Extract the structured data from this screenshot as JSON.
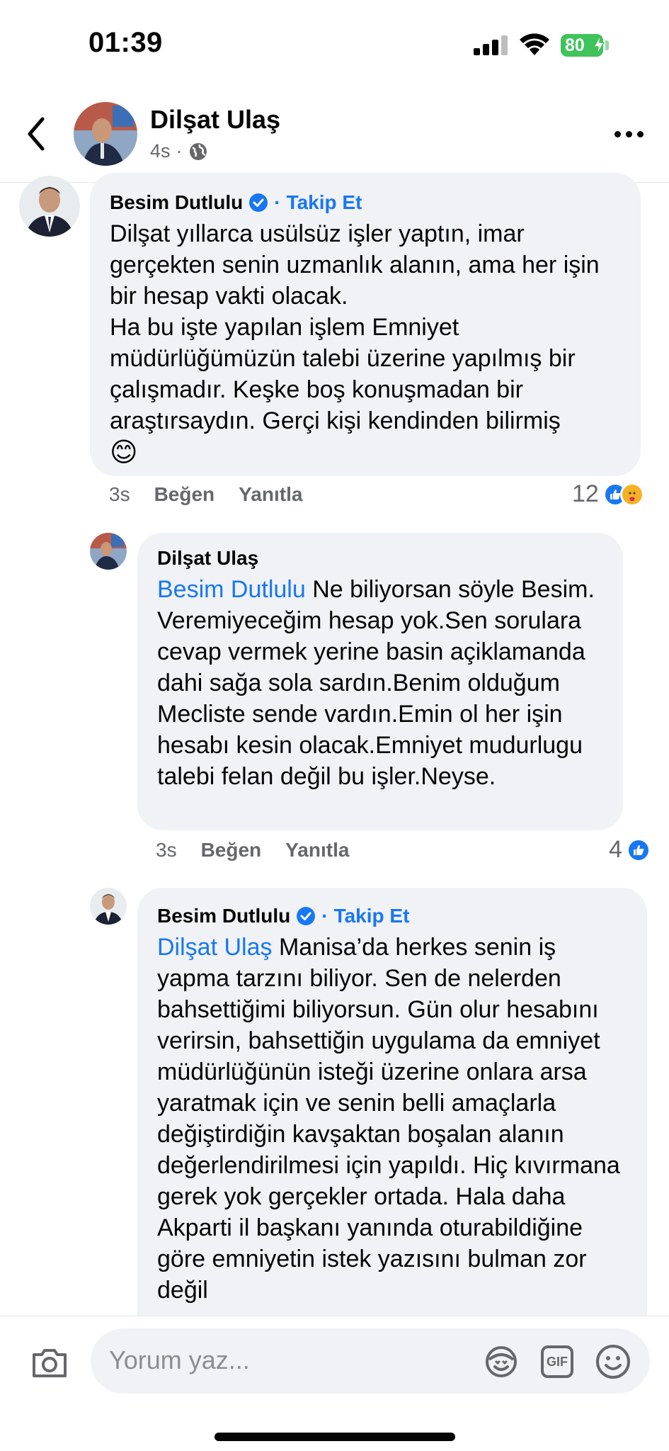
{
  "status_bar": {
    "time": "01:39",
    "battery": "80"
  },
  "header": {
    "name": "Dilşat Ulaş",
    "time": "4s",
    "privacy_icon": "globe-icon"
  },
  "comments": [
    {
      "author": "Besim Dutlulu",
      "verified": true,
      "separator": "·",
      "follow": "Takip Et",
      "mention": "",
      "text": "Dilşat yıllarca usülsüz işler yaptın, imar gerçekten senin uzmanlık alanın, ama her işin bir hesap vakti olacak.\nHa bu işte yapılan işlem Emniyet müdürlüğümüzün talebi üzerine yapılmış bir çalışmadır. Keşke boş konuşmadan bir araştırsaydın. Gerçi kişi kendinden bilirmiş",
      "emoji": "😊",
      "time": "3s",
      "like": "Beğen",
      "reply": "Yanıtla",
      "reaction_count": "12"
    },
    {
      "author": "Dilşat Ulaş",
      "mention": "Besim Dutlulu",
      "text": "Ne biliyorsan söyle Besim. Veremiyeceğim hesap yok.Sen sorulara cevap vermek yerine basin açiklamanda dahi sağa sola sardın.Benim olduğum Mecliste sende vardın.Emin ol her işin hesabı kesin olacak.Emniyet mudurlugu talebi felan değil bu işler.Neyse.",
      "time": "3s",
      "like": "Beğen",
      "reply": "Yanıtla",
      "reaction_count": "4"
    },
    {
      "author": "Besim Dutlulu",
      "verified": true,
      "separator": "·",
      "follow": "Takip Et",
      "mention": "Dilşat Ulaş",
      "text": "Manisa’da herkes senin iş yapma tarzını biliyor. Sen de nelerden bahsettiğimi biliyorsun. Gün olur hesabını verirsin, bahsettiğin uygulama da emniyet müdürlüğünün isteği üzerine onlara arsa yaratmak için ve senin belli amaçlarla değiştirdiğin kavşaktan boşalan alanın değerlendirilmesi için yapıldı. Hiç kıvırmana gerek yok gerçekler ortada. Hala daha Akparti il başkanı yanında oturabildiğine göre emniyetin istek yazısını bulman zor değil"
    }
  ],
  "composer": {
    "placeholder": "Yorum yaz...",
    "gif": "GIF"
  }
}
